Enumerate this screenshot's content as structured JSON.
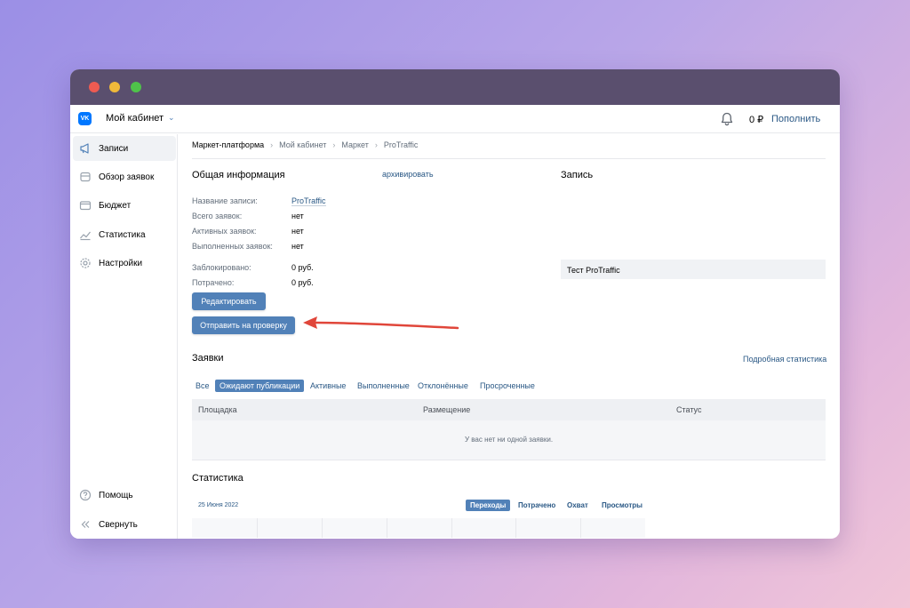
{
  "topbar": {
    "title": "Мой кабинет",
    "balance": "0 ₽",
    "topup_label": "Пополнить"
  },
  "sidebar": {
    "items": [
      {
        "label": "Записи",
        "icon": "megaphone-icon"
      },
      {
        "label": "Обзор заявок",
        "icon": "archive-icon"
      },
      {
        "label": "Бюджет",
        "icon": "wallet-icon"
      },
      {
        "label": "Статистика",
        "icon": "chart-icon"
      },
      {
        "label": "Настройки",
        "icon": "gear-icon"
      }
    ],
    "help_label": "Помощь",
    "collapse_label": "Свернуть"
  },
  "breadcrumb": [
    "Маркет-платформа",
    "Мой кабинет",
    "Маркет",
    "ProTraffic"
  ],
  "general": {
    "title": "Общая информация",
    "archive_label": "архивировать",
    "fields": [
      {
        "label": "Название записи:",
        "value": "ProTraffic"
      },
      {
        "label": "Всего заявок:",
        "value": "нет"
      },
      {
        "label": "Активных заявок:",
        "value": "нет"
      },
      {
        "label": "Выполненных заявок:",
        "value": "нет"
      },
      {
        "label": "Заблокировано:",
        "value": "0 руб."
      },
      {
        "label": "Потрачено:",
        "value": "0 руб."
      }
    ],
    "edit_label": "Редактировать",
    "submit_label": "Отправить на проверку"
  },
  "record": {
    "title": "Запись",
    "text": "Тест ProTraffic"
  },
  "requests": {
    "title": "Заявки",
    "detailed_label": "Подробная статистика",
    "tabs": [
      "Все",
      "Ожидают публикации",
      "Активные",
      "Выполненные",
      "Отклонённые",
      "Просроченные"
    ],
    "active_tab": 1,
    "columns": [
      "Площадка",
      "Размещение",
      "Статус"
    ],
    "empty_text": "У вас нет ни одной заявки."
  },
  "statistics": {
    "title": "Статистика",
    "date": "25 Июня 2022",
    "metrics": [
      "Переходы",
      "Потрачено",
      "Охват",
      "Просмотры"
    ],
    "active_metric": 0
  },
  "colors": {
    "accent": "#5181b8",
    "link": "#2a5885",
    "vk_blue": "#0077ff",
    "titlebar": "#5a4f6e",
    "arrow": "#e0463a"
  }
}
